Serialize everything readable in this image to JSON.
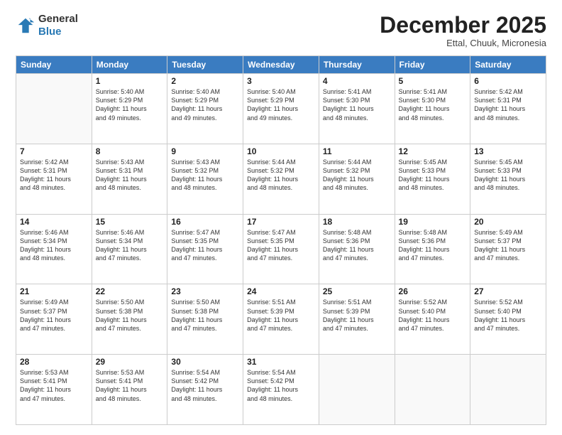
{
  "header": {
    "logo": {
      "line1": "General",
      "line2": "Blue"
    },
    "title": "December 2025",
    "location": "Ettal, Chuuk, Micronesia"
  },
  "days": [
    "Sunday",
    "Monday",
    "Tuesday",
    "Wednesday",
    "Thursday",
    "Friday",
    "Saturday"
  ],
  "weeks": [
    [
      {
        "day": "",
        "content": ""
      },
      {
        "day": "1",
        "content": "Sunrise: 5:40 AM\nSunset: 5:29 PM\nDaylight: 11 hours\nand 49 minutes."
      },
      {
        "day": "2",
        "content": "Sunrise: 5:40 AM\nSunset: 5:29 PM\nDaylight: 11 hours\nand 49 minutes."
      },
      {
        "day": "3",
        "content": "Sunrise: 5:40 AM\nSunset: 5:29 PM\nDaylight: 11 hours\nand 49 minutes."
      },
      {
        "day": "4",
        "content": "Sunrise: 5:41 AM\nSunset: 5:30 PM\nDaylight: 11 hours\nand 48 minutes."
      },
      {
        "day": "5",
        "content": "Sunrise: 5:41 AM\nSunset: 5:30 PM\nDaylight: 11 hours\nand 48 minutes."
      },
      {
        "day": "6",
        "content": "Sunrise: 5:42 AM\nSunset: 5:31 PM\nDaylight: 11 hours\nand 48 minutes."
      }
    ],
    [
      {
        "day": "7",
        "content": "Sunrise: 5:42 AM\nSunset: 5:31 PM\nDaylight: 11 hours\nand 48 minutes."
      },
      {
        "day": "8",
        "content": "Sunrise: 5:43 AM\nSunset: 5:31 PM\nDaylight: 11 hours\nand 48 minutes."
      },
      {
        "day": "9",
        "content": "Sunrise: 5:43 AM\nSunset: 5:32 PM\nDaylight: 11 hours\nand 48 minutes."
      },
      {
        "day": "10",
        "content": "Sunrise: 5:44 AM\nSunset: 5:32 PM\nDaylight: 11 hours\nand 48 minutes."
      },
      {
        "day": "11",
        "content": "Sunrise: 5:44 AM\nSunset: 5:32 PM\nDaylight: 11 hours\nand 48 minutes."
      },
      {
        "day": "12",
        "content": "Sunrise: 5:45 AM\nSunset: 5:33 PM\nDaylight: 11 hours\nand 48 minutes."
      },
      {
        "day": "13",
        "content": "Sunrise: 5:45 AM\nSunset: 5:33 PM\nDaylight: 11 hours\nand 48 minutes."
      }
    ],
    [
      {
        "day": "14",
        "content": "Sunrise: 5:46 AM\nSunset: 5:34 PM\nDaylight: 11 hours\nand 48 minutes."
      },
      {
        "day": "15",
        "content": "Sunrise: 5:46 AM\nSunset: 5:34 PM\nDaylight: 11 hours\nand 47 minutes."
      },
      {
        "day": "16",
        "content": "Sunrise: 5:47 AM\nSunset: 5:35 PM\nDaylight: 11 hours\nand 47 minutes."
      },
      {
        "day": "17",
        "content": "Sunrise: 5:47 AM\nSunset: 5:35 PM\nDaylight: 11 hours\nand 47 minutes."
      },
      {
        "day": "18",
        "content": "Sunrise: 5:48 AM\nSunset: 5:36 PM\nDaylight: 11 hours\nand 47 minutes."
      },
      {
        "day": "19",
        "content": "Sunrise: 5:48 AM\nSunset: 5:36 PM\nDaylight: 11 hours\nand 47 minutes."
      },
      {
        "day": "20",
        "content": "Sunrise: 5:49 AM\nSunset: 5:37 PM\nDaylight: 11 hours\nand 47 minutes."
      }
    ],
    [
      {
        "day": "21",
        "content": "Sunrise: 5:49 AM\nSunset: 5:37 PM\nDaylight: 11 hours\nand 47 minutes."
      },
      {
        "day": "22",
        "content": "Sunrise: 5:50 AM\nSunset: 5:38 PM\nDaylight: 11 hours\nand 47 minutes."
      },
      {
        "day": "23",
        "content": "Sunrise: 5:50 AM\nSunset: 5:38 PM\nDaylight: 11 hours\nand 47 minutes."
      },
      {
        "day": "24",
        "content": "Sunrise: 5:51 AM\nSunset: 5:39 PM\nDaylight: 11 hours\nand 47 minutes."
      },
      {
        "day": "25",
        "content": "Sunrise: 5:51 AM\nSunset: 5:39 PM\nDaylight: 11 hours\nand 47 minutes."
      },
      {
        "day": "26",
        "content": "Sunrise: 5:52 AM\nSunset: 5:40 PM\nDaylight: 11 hours\nand 47 minutes."
      },
      {
        "day": "27",
        "content": "Sunrise: 5:52 AM\nSunset: 5:40 PM\nDaylight: 11 hours\nand 47 minutes."
      }
    ],
    [
      {
        "day": "28",
        "content": "Sunrise: 5:53 AM\nSunset: 5:41 PM\nDaylight: 11 hours\nand 47 minutes."
      },
      {
        "day": "29",
        "content": "Sunrise: 5:53 AM\nSunset: 5:41 PM\nDaylight: 11 hours\nand 48 minutes."
      },
      {
        "day": "30",
        "content": "Sunrise: 5:54 AM\nSunset: 5:42 PM\nDaylight: 11 hours\nand 48 minutes."
      },
      {
        "day": "31",
        "content": "Sunrise: 5:54 AM\nSunset: 5:42 PM\nDaylight: 11 hours\nand 48 minutes."
      },
      {
        "day": "",
        "content": ""
      },
      {
        "day": "",
        "content": ""
      },
      {
        "day": "",
        "content": ""
      }
    ]
  ]
}
